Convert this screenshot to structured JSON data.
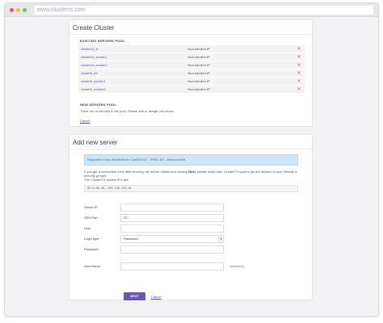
{
  "browser": {
    "url": "www.clustercs.com"
  },
  "create_cluster": {
    "title": "Create Cluster",
    "existing_label": "EXISTING SERVERS POOL",
    "servers": [
      {
        "name": "cluster10_lb",
        "ip": "Your server's IP"
      },
      {
        "name": "cluster10_worker1",
        "ip": "Your server's IP"
      },
      {
        "name": "cluster10_worker2",
        "ip": "Your server's IP"
      },
      {
        "name": "cluster6_db",
        "ip": "Your server's IP"
      },
      {
        "name": "cluster6_worker1",
        "ip": "Your server's IP"
      },
      {
        "name": "cluster6_worker2",
        "ip": "Your server's IP"
      }
    ],
    "delete_glyph": "✕",
    "new_label": "NEW SERVERS POOL",
    "new_note": "There are no servers in the pool. Please add or assign one below.",
    "cancel": "Cancel"
  },
  "add_server": {
    "title": "Add new server",
    "info": "Supported Linux distributions: CentOS 6/7 , RHEL 6/7 , Amazon AMI",
    "hint_pre": "If you get a connection error after entering the server details and clicking ",
    "hint_bold": "Next",
    "hint_post": ", please make sure ClusterCS system ips are allowed in your firewall or security groups.",
    "hint_line2": "The ClusterCS system IP's are:",
    "system_ips": "95.0.00.46, 193.226.133.91",
    "fields": {
      "server_ip": {
        "label": "Server IP",
        "value": ""
      },
      "ssh_port": {
        "label": "SSH Port",
        "value": "22"
      },
      "user": {
        "label": "User",
        "value": ""
      },
      "login_type": {
        "label": "Login type",
        "value": "Password"
      },
      "password": {
        "label": "Password",
        "value": ""
      },
      "host_name": {
        "label": "Host Name",
        "value": "",
        "note": "(optional)"
      }
    },
    "next": "NEXT",
    "cancel": "Cancel"
  }
}
